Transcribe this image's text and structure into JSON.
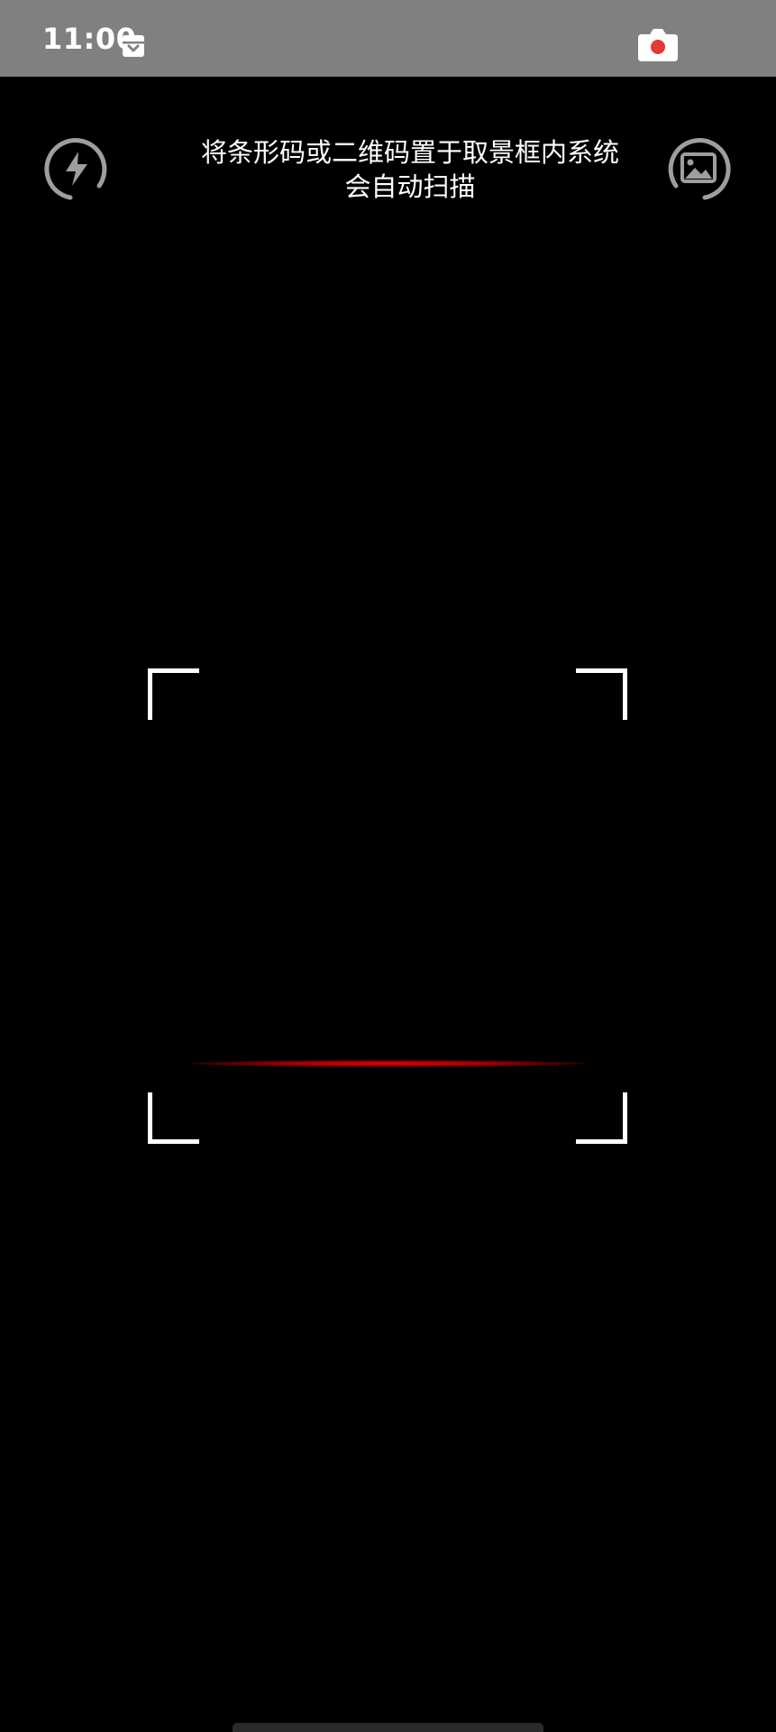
{
  "status_bar": {
    "time": "11:00",
    "background": "#808080",
    "notification_icon": "archive-box-icon",
    "camera_icon": "screen-record-camera-icon"
  },
  "scanner": {
    "hint": "将条形码或二维码置于取景框内系统会自动扫描",
    "flash_icon": "flash-icon",
    "gallery_icon": "gallery-icon",
    "icon_color": "#9e9e9e",
    "scan_line_color": "#e00000",
    "frame_color": "#ffffff"
  }
}
